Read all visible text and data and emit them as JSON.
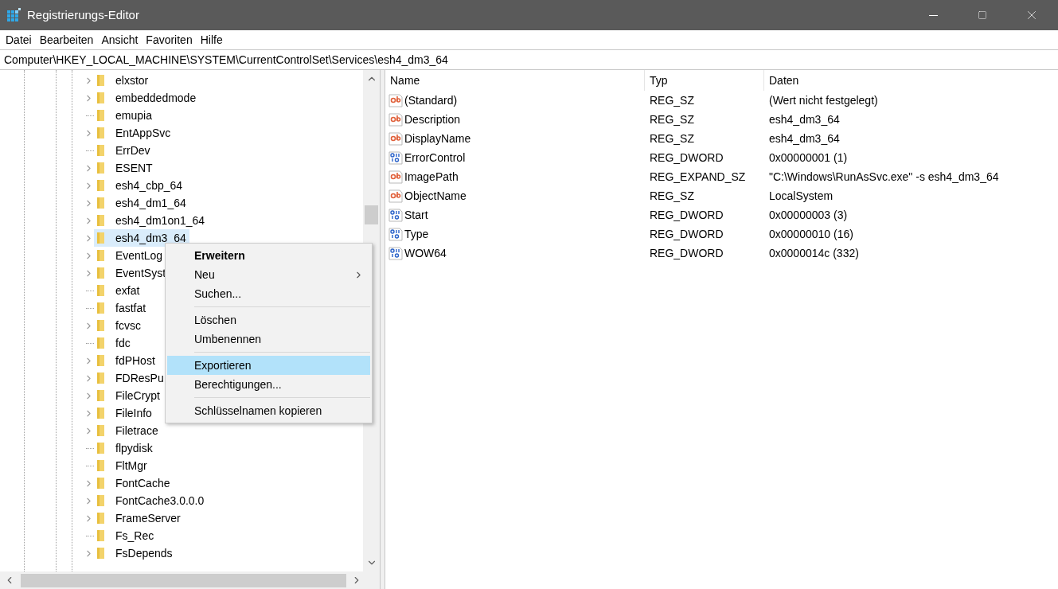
{
  "window": {
    "title": "Registrierungs-Editor"
  },
  "menu_bar": [
    "Datei",
    "Bearbeiten",
    "Ansicht",
    "Favoriten",
    "Hilfe"
  ],
  "address": "Computer\\HKEY_LOCAL_MACHINE\\SYSTEM\\CurrentControlSet\\Services\\esh4_dm3_64",
  "tree": [
    {
      "label": "elxstor",
      "kind": "expandable",
      "selected": false
    },
    {
      "label": "embeddedmode",
      "kind": "expandable",
      "selected": false
    },
    {
      "label": "emupia",
      "kind": "leaf",
      "selected": false
    },
    {
      "label": "EntAppSvc",
      "kind": "expandable",
      "selected": false
    },
    {
      "label": "ErrDev",
      "kind": "leaf",
      "selected": false
    },
    {
      "label": "ESENT",
      "kind": "expandable",
      "selected": false
    },
    {
      "label": "esh4_cbp_64",
      "kind": "expandable",
      "selected": false
    },
    {
      "label": "esh4_dm1_64",
      "kind": "expandable",
      "selected": false
    },
    {
      "label": "esh4_dm1on1_64",
      "kind": "expandable",
      "selected": false
    },
    {
      "label": "esh4_dm3_64",
      "kind": "expandable",
      "selected": true
    },
    {
      "label": "EventLog",
      "kind": "expandable",
      "selected": false
    },
    {
      "label": "EventSyst",
      "kind": "expandable",
      "selected": false
    },
    {
      "label": "exfat",
      "kind": "leaf",
      "selected": false
    },
    {
      "label": "fastfat",
      "kind": "leaf",
      "selected": false
    },
    {
      "label": "fcvsc",
      "kind": "expandable",
      "selected": false
    },
    {
      "label": "fdc",
      "kind": "leaf",
      "selected": false
    },
    {
      "label": "fdPHost",
      "kind": "expandable",
      "selected": false
    },
    {
      "label": "FDResPu",
      "kind": "expandable",
      "selected": false
    },
    {
      "label": "FileCrypt",
      "kind": "expandable",
      "selected": false
    },
    {
      "label": "FileInfo",
      "kind": "expandable",
      "selected": false
    },
    {
      "label": "Filetrace",
      "kind": "expandable",
      "selected": false
    },
    {
      "label": "flpydisk",
      "kind": "leaf",
      "selected": false
    },
    {
      "label": "FltMgr",
      "kind": "leaf",
      "selected": false
    },
    {
      "label": "FontCache",
      "kind": "expandable",
      "selected": false
    },
    {
      "label": "FontCache3.0.0.0",
      "kind": "expandable",
      "selected": false
    },
    {
      "label": "FrameServer",
      "kind": "expandable",
      "selected": false
    },
    {
      "label": "Fs_Rec",
      "kind": "leaf",
      "selected": false
    },
    {
      "label": "FsDepends",
      "kind": "expandable",
      "selected": false
    }
  ],
  "table": {
    "columns": [
      "Name",
      "Typ",
      "Daten"
    ],
    "rows": [
      {
        "kind": "string",
        "name": "(Standard)",
        "type": "REG_SZ",
        "data": "(Wert nicht festgelegt)"
      },
      {
        "kind": "string",
        "name": "Description",
        "type": "REG_SZ",
        "data": "esh4_dm3_64"
      },
      {
        "kind": "string",
        "name": "DisplayName",
        "type": "REG_SZ",
        "data": "esh4_dm3_64"
      },
      {
        "kind": "binary",
        "name": "ErrorControl",
        "type": "REG_DWORD",
        "data": "0x00000001 (1)"
      },
      {
        "kind": "string",
        "name": "ImagePath",
        "type": "REG_EXPAND_SZ",
        "data": "\"C:\\Windows\\RunAsSvc.exe\" -s esh4_dm3_64"
      },
      {
        "kind": "string",
        "name": "ObjectName",
        "type": "REG_SZ",
        "data": "LocalSystem"
      },
      {
        "kind": "binary",
        "name": "Start",
        "type": "REG_DWORD",
        "data": "0x00000003 (3)"
      },
      {
        "kind": "binary",
        "name": "Type",
        "type": "REG_DWORD",
        "data": "0x00000010 (16)"
      },
      {
        "kind": "binary",
        "name": "WOW64",
        "type": "REG_DWORD",
        "data": "0x0000014c (332)"
      }
    ]
  },
  "context_menu": [
    {
      "kind": "item",
      "label": "Erweitern",
      "bold": true,
      "submenu": false,
      "selected": false
    },
    {
      "kind": "item",
      "label": "Neu",
      "bold": false,
      "submenu": true,
      "selected": false
    },
    {
      "kind": "item",
      "label": "Suchen...",
      "bold": false,
      "submenu": false,
      "selected": false
    },
    {
      "kind": "separator"
    },
    {
      "kind": "item",
      "label": "Löschen",
      "bold": false,
      "submenu": false,
      "selected": false
    },
    {
      "kind": "item",
      "label": "Umbenennen",
      "bold": false,
      "submenu": false,
      "selected": false
    },
    {
      "kind": "separator"
    },
    {
      "kind": "item",
      "label": "Exportieren",
      "bold": false,
      "submenu": false,
      "selected": true
    },
    {
      "kind": "item",
      "label": "Berechtigungen...",
      "bold": false,
      "submenu": false,
      "selected": false
    },
    {
      "kind": "separator"
    },
    {
      "kind": "item",
      "label": "Schlüsselnamen kopieren",
      "bold": false,
      "submenu": false,
      "selected": false
    }
  ]
}
